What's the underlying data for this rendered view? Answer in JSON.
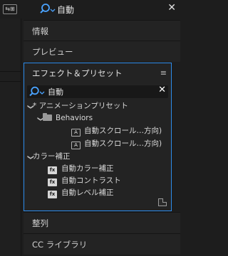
{
  "topbar": {
    "workspace_button_label": "⇆⊞",
    "search_value": "自動",
    "clear_label": "✕"
  },
  "panels": {
    "info": "情報",
    "preview": "プレビュー",
    "align": "整列",
    "cc_libraries": "CC ライブラリ"
  },
  "effects_presets": {
    "title": "エフェクト＆プリセット",
    "menu_icon_glyph": "≡",
    "search_value": "自動",
    "clear_label": "✕",
    "tree": {
      "animation_presets": "* アニメーションプリセット",
      "behaviors_folder": "Behaviors",
      "preset_items": [
        "自動スクロール…方向)",
        "自動スクロール…方向)"
      ],
      "color_correction": "カラー補正",
      "effects": [
        "自動カラー補正",
        "自動コントラスト",
        "自動レベル補正"
      ]
    }
  },
  "icons": {
    "search": "search-icon",
    "clear": "close-icon",
    "menu": "hamburger-menu-icon",
    "folder": "folder-icon",
    "preset": "animation-preset-icon",
    "effect": "effect-icon",
    "new_bin": "new-bin-icon"
  },
  "colors": {
    "accent_border": "#2d8ceb",
    "search_icon": "#4aa3ff"
  }
}
